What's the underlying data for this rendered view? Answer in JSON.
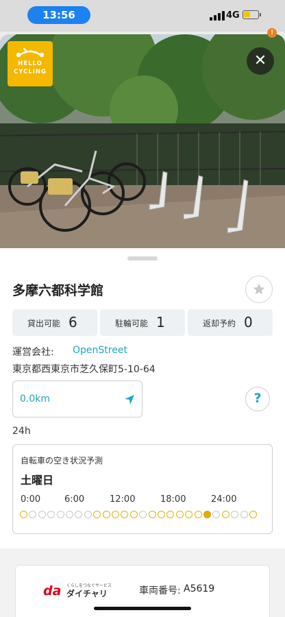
{
  "status_bar": {
    "time": "13:56",
    "network": "4G",
    "notification_badge": "!"
  },
  "photo": {
    "logo_line1": "HELLO",
    "logo_line2": "CYCLING",
    "close_label": "✕"
  },
  "station": {
    "name": "多摩六都科学館",
    "stats": [
      {
        "label": "貸出可能",
        "value": "6"
      },
      {
        "label": "駐輪可能",
        "value": "1"
      },
      {
        "label": "返却予約",
        "value": "0"
      }
    ],
    "operator_label": "運営会社:",
    "operator_value": "OpenStreet",
    "address": "東京都西東京市芝久保町5-10-64",
    "distance": "0.0km",
    "help_label": "?",
    "hours": "24h"
  },
  "forecast": {
    "title": "自転車の空き状況予測",
    "day": "土曜日",
    "ticks": [
      "0:00",
      "6:00",
      "12:00",
      "18:00",
      "24:00"
    ],
    "hourly_availability": [
      1,
      0,
      0,
      0,
      0,
      0,
      0,
      0,
      1,
      1,
      1,
      1,
      1,
      0,
      1,
      1,
      1,
      1,
      1,
      1,
      2,
      0,
      1,
      0,
      0,
      1
    ],
    "availability_legend": {
      "0": "none",
      "1": "available",
      "2": "current-hour"
    },
    "colors": {
      "available": "#e5b000",
      "none": "#c9c9c9",
      "current": "#e5aa00"
    }
  },
  "bike": {
    "brand_tagline": "くらしをつなぐサービス",
    "brand_name": "ダイチャリ",
    "brand_mark": "da",
    "vehicle_label": "車両番号:",
    "vehicle_value": "A5619"
  },
  "colors": {
    "accent": "#1ba6c4",
    "brand_yellow": "#f5b800",
    "time_pill": "#1c82f0"
  }
}
